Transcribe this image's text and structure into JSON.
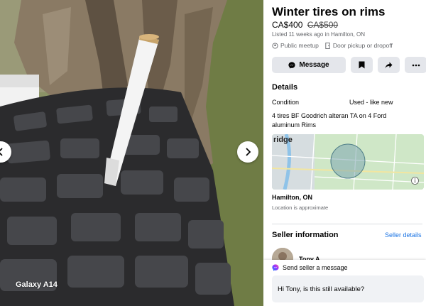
{
  "photo": {
    "watermark": "Galaxy A14",
    "prev_icon": "chevron-left-icon",
    "next_icon": "chevron-right-icon"
  },
  "listing": {
    "title": "Winter tires on rims",
    "price": "CA$400",
    "old_price": "CA$500",
    "listed": "Listed 11 weeks ago in Hamilton, ON",
    "meetup": "Public meetup",
    "pickup": "Door pickup or dropoff"
  },
  "actions": {
    "message_label": "Message",
    "message_icon": "messenger-icon",
    "save_icon": "bookmark-icon",
    "share_icon": "share-icon",
    "more_icon": "more-icon"
  },
  "details": {
    "heading": "Details",
    "condition_label": "Condition",
    "condition_value": "Used - like new",
    "description": "4 tires BF Goodrich alteran TA on 4 Ford aluminum  Rims"
  },
  "map": {
    "label": "ridge",
    "location": "Hamilton, ON",
    "location_note": "Location is approximate"
  },
  "seller": {
    "heading": "Seller information",
    "details_link": "Seller details",
    "name": "Tony A"
  },
  "message_box": {
    "label": "Send seller a message",
    "value": "Hi Tony, is this still available?"
  },
  "colors": {
    "link": "#1b74e4",
    "button_bg": "#e4e6eb",
    "secondary_text": "#65676b"
  }
}
